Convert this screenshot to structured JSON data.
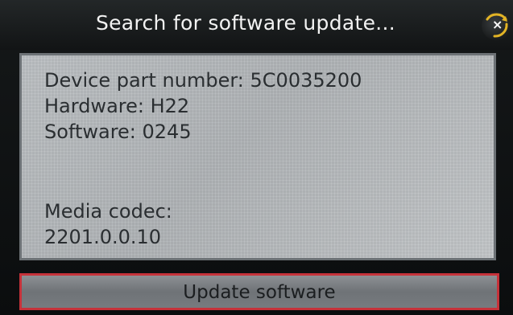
{
  "dialog": {
    "title": "Search for software update...",
    "close_icon_glyph": "×"
  },
  "info": {
    "device_part_number": "Device part number: 5C0035200",
    "hardware": "Hardware: H22",
    "software": "Software: 0245",
    "media_codec_label": "Media codec:",
    "media_codec_value": "2201.0.0.10"
  },
  "actions": {
    "update_label": "Update software"
  },
  "colors": {
    "title_bar": "#1a1d1e",
    "panel_background": "#b8bcbf",
    "button_border": "#c6323a",
    "close_ring": "#e2b325"
  }
}
